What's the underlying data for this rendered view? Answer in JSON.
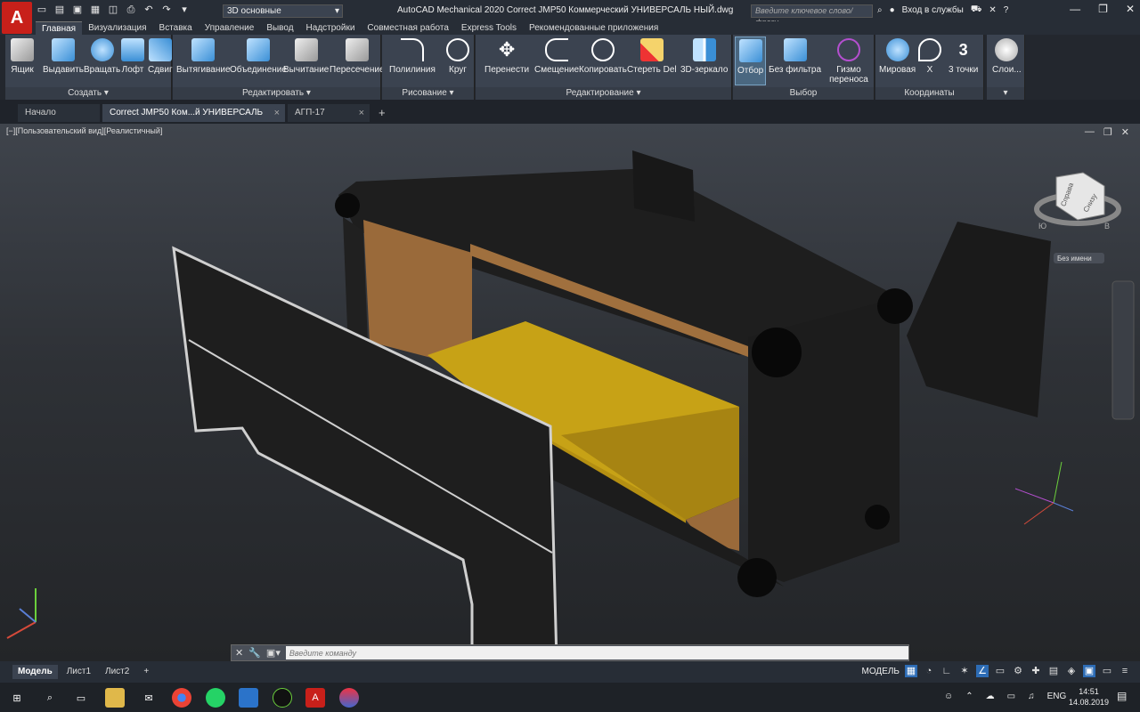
{
  "titlebar": {
    "app": "A",
    "workspace": "3D основные",
    "title": "AutoCAD Mechanical 2020    Correct JMP50 Коммерческий УНИВЕРСАЛЬ НЫЙ.dwg",
    "search_placeholder": "Введите ключевое слово/фразу",
    "signin": "Вход в службы"
  },
  "ribbon_tabs": [
    "Главная",
    "Визуализация",
    "Вставка",
    "Управление",
    "Вывод",
    "Надстройки",
    "Совместная работа",
    "Express Tools",
    "Рекомендованные приложения"
  ],
  "panels": {
    "create": "Создать",
    "edit": "Редактировать",
    "draw": "Рисование",
    "modify": "Редактирование",
    "select": "Выбор",
    "coords": "Координаты"
  },
  "tools": {
    "box": "Ящик",
    "extrude": "Выдавить",
    "revolve": "Вращать",
    "loft": "Лофт",
    "sweep": "Сдвиг",
    "presspull": "Вытягивание",
    "union": "Объединение",
    "subtract": "Вычитание",
    "intersect": "Пересечение",
    "polyline": "Полилиния",
    "circle": "Круг",
    "move": "Перенести",
    "offset": "Смещение",
    "copy": "Копировать",
    "erase": "Стереть Del",
    "mirror3d": "3D-зеркало",
    "culling": "Отбор",
    "nofilter": "Без фильтра",
    "gizmo": "Гизмо переноса",
    "world": "Мировая",
    "x": "X",
    "threepoint": "3 точки",
    "layers": "Слои..."
  },
  "doc_tabs": [
    "Начало",
    "Correct JMP50 Ком...й УНИВЕРСАЛЬ НЫЙ*",
    "АГП-17"
  ],
  "viewport": {
    "label": "[−][Пользовательский вид][Реалистичный]",
    "wcs": "Без имени",
    "viewcube_front": "Справа",
    "viewcube_side": "Снизу",
    "compass_left": "Ю",
    "compass_right": "В"
  },
  "command": {
    "placeholder": "Введите команду"
  },
  "layout_tabs": [
    "Модель",
    "Лист1",
    "Лист2"
  ],
  "status": {
    "model": "МОДЕЛЬ"
  },
  "taskbar": {
    "lang": "ENG",
    "time": "14:51",
    "date": "14.08.2019"
  }
}
